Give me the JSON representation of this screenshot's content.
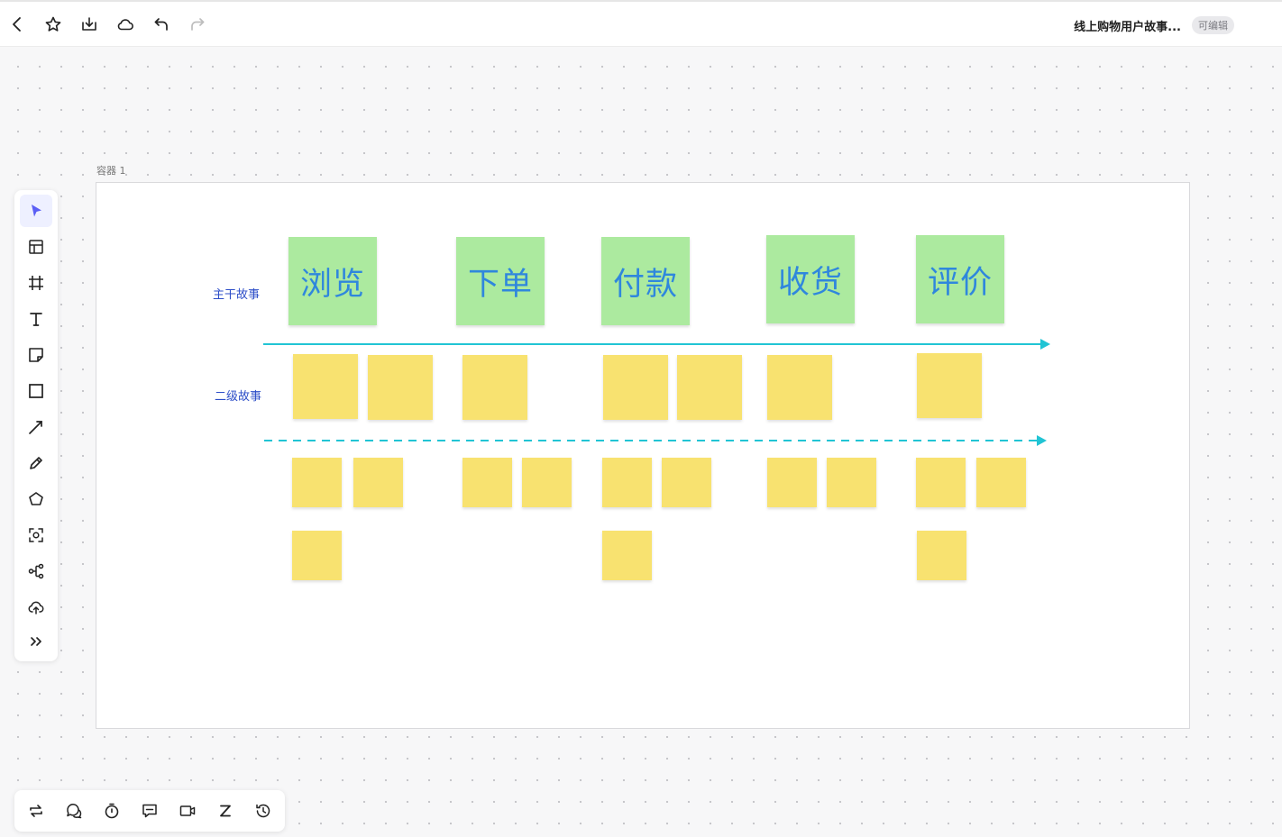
{
  "topbar": {
    "title": "线上购物用户故事...",
    "badge": "可编辑",
    "icons": [
      "back-icon",
      "star-icon",
      "download-icon",
      "cloud-icon",
      "undo-icon",
      "redo-icon"
    ]
  },
  "container": {
    "label": "容器 1"
  },
  "rows": {
    "main_label": "主干故事",
    "secondary_label": "二级故事"
  },
  "epics": [
    "浏览",
    "下单",
    "付款",
    "收货",
    "评价"
  ],
  "colors": {
    "epic_bg": "#acea9f",
    "epic_text": "#2f87dd",
    "note_bg": "#f8e270",
    "arrow": "#21c4d4",
    "row_label": "#2d4ec8",
    "active_tool": "#5b5ff5"
  },
  "left_toolbar": {
    "tools": [
      "select",
      "template",
      "frame",
      "text",
      "sticky-note",
      "rectangle",
      "connector",
      "pen",
      "shape",
      "ai-recognize",
      "mind-map",
      "upload",
      "more"
    ],
    "active": "select"
  },
  "bottom_toolbar": {
    "tools": [
      "switch",
      "comments",
      "timer",
      "feedback",
      "video",
      "zoom-fit",
      "history"
    ]
  }
}
